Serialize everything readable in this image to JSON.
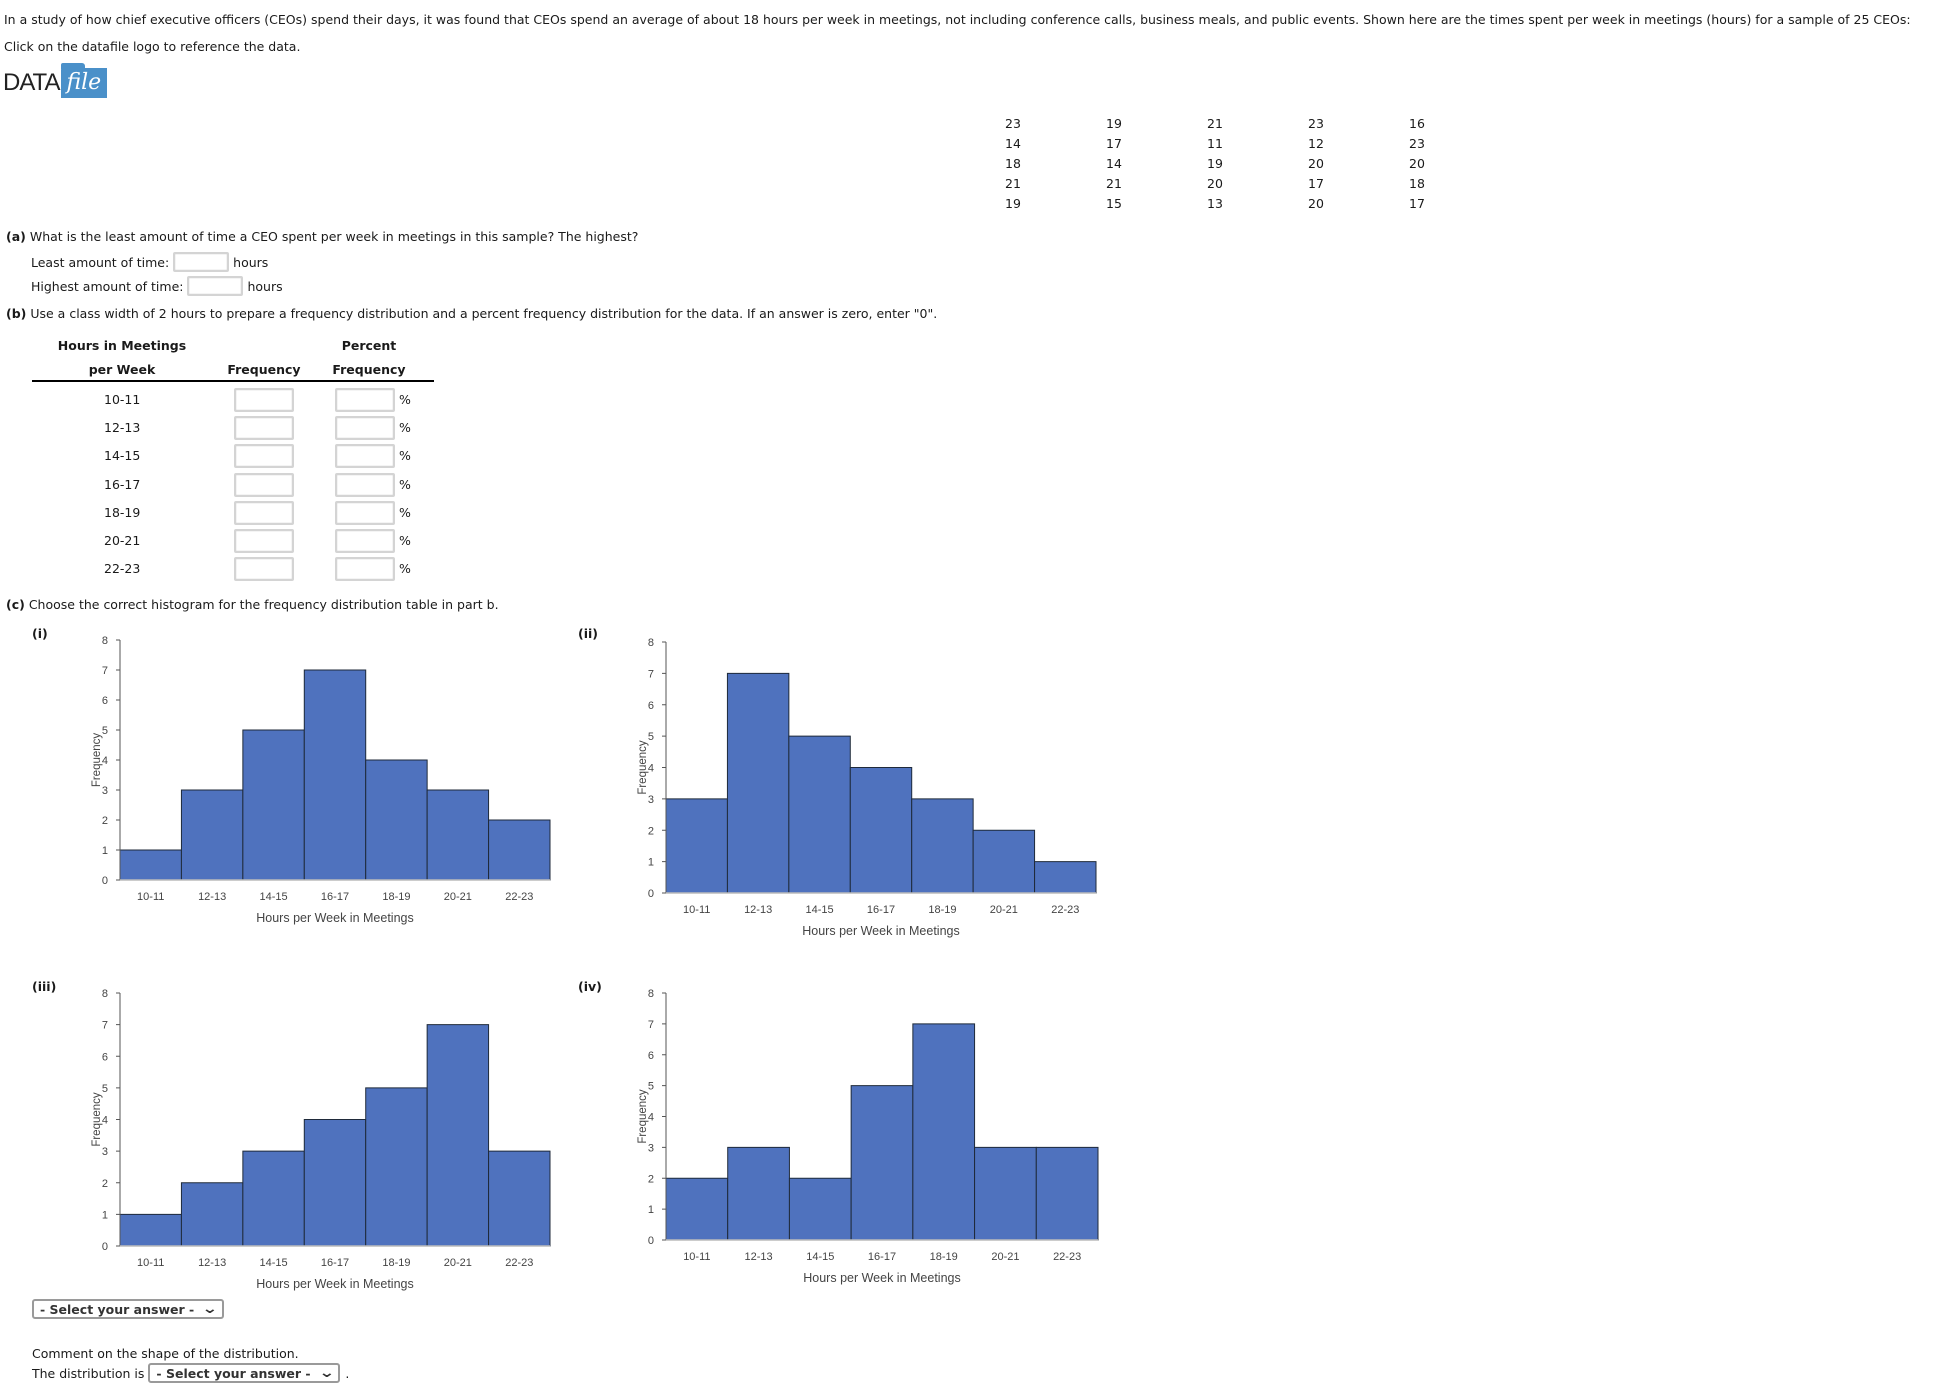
{
  "intro": {
    "text": "In a study of how chief executive officers (CEOs) spend their days, it was found that CEOs spend an average of about 18 hours per week in meetings, not including conference calls, business meals, and public events. Shown here are the times spent per week in meetings (hours) for a sample of 25 CEOs:",
    "datafile_note": "Click on the datafile logo to reference the data."
  },
  "logo": {
    "data": "DATA",
    "file": "file",
    "icon": "datafile-logo-icon"
  },
  "sample_data": [
    [
      "23",
      "19",
      "21",
      "23",
      "16"
    ],
    [
      "14",
      "17",
      "11",
      "12",
      "23"
    ],
    [
      "18",
      "14",
      "19",
      "20",
      "20"
    ],
    [
      "21",
      "21",
      "20",
      "17",
      "18"
    ],
    [
      "19",
      "15",
      "13",
      "20",
      "17"
    ]
  ],
  "part_a": {
    "label": "(a)",
    "question": "What is the least amount of time a CEO spent per week in meetings in this sample? The highest?",
    "least_label": "Least amount of time:",
    "least_value": "",
    "highest_label": "Highest amount of time:",
    "highest_value": "",
    "unit": "hours"
  },
  "part_b": {
    "label": "(b)",
    "question": "Use a class width of 2 hours to prepare a frequency distribution and a percent frequency distribution for the data. If an answer is zero, enter \"0\".",
    "headers": {
      "col1_line1": "Hours in Meetings",
      "col1_line2": "per Week",
      "col2": "Frequency",
      "col3_line1": "Percent",
      "col3_line2": "Frequency"
    },
    "percent_sign": "%",
    "rows": [
      {
        "class": "10-11",
        "frequency": "",
        "percent": ""
      },
      {
        "class": "12-13",
        "frequency": "",
        "percent": ""
      },
      {
        "class": "14-15",
        "frequency": "",
        "percent": ""
      },
      {
        "class": "16-17",
        "frequency": "",
        "percent": ""
      },
      {
        "class": "18-19",
        "frequency": "",
        "percent": ""
      },
      {
        "class": "20-21",
        "frequency": "",
        "percent": ""
      },
      {
        "class": "22-23",
        "frequency": "",
        "percent": ""
      }
    ]
  },
  "part_c": {
    "label": "(c)",
    "question": "Choose the correct histogram for the frequency distribution table in part b.",
    "answer_select": "- Select your answer -",
    "shape_prompt": "Comment on the shape of the distribution.",
    "shape_prefix": "The distribution is",
    "shape_select": "- Select your answer -",
    "shape_suffix": "."
  },
  "colors": {
    "bar": "#4F72BE",
    "bar_edge": "#1f2a3a",
    "logo_blue": "#4A90C9"
  },
  "chart_data": [
    {
      "id": "i",
      "label": "(i)",
      "type": "bar",
      "categories": [
        "10-11",
        "12-13",
        "14-15",
        "16-17",
        "18-19",
        "20-21",
        "22-23"
      ],
      "values": [
        1,
        3,
        5,
        7,
        4,
        3,
        2
      ],
      "xlabel": "Hours per Week in Meetings",
      "ylabel": "Frequency",
      "ylim": [
        0,
        8
      ],
      "yticks": [
        0,
        1,
        2,
        3,
        4,
        5,
        6,
        7,
        8
      ],
      "grid": false
    },
    {
      "id": "ii",
      "label": "(ii)",
      "type": "bar",
      "categories": [
        "10-11",
        "12-13",
        "14-15",
        "16-17",
        "18-19",
        "20-21",
        "22-23"
      ],
      "values": [
        3,
        7,
        5,
        4,
        3,
        2,
        1
      ],
      "xlabel": "Hours per Week in Meetings",
      "ylabel": "Frequency",
      "ylim": [
        0,
        8
      ],
      "yticks": [
        0,
        1,
        2,
        3,
        4,
        5,
        6,
        7,
        8
      ],
      "grid": false
    },
    {
      "id": "iii",
      "label": "(iii)",
      "type": "bar",
      "categories": [
        "10-11",
        "12-13",
        "14-15",
        "16-17",
        "18-19",
        "20-21",
        "22-23"
      ],
      "values": [
        1,
        2,
        3,
        4,
        5,
        7,
        3
      ],
      "xlabel": "Hours per Week in Meetings",
      "ylabel": "Frequency",
      "ylim": [
        0,
        8
      ],
      "yticks": [
        0,
        1,
        2,
        3,
        4,
        5,
        6,
        7,
        8
      ],
      "grid": false
    },
    {
      "id": "iv",
      "label": "(iv)",
      "type": "bar",
      "categories": [
        "10-11",
        "12-13",
        "14-15",
        "16-17",
        "18-19",
        "20-21",
        "22-23"
      ],
      "values": [
        2,
        3,
        2,
        5,
        7,
        3,
        3
      ],
      "xlabel": "Hours per Week in Meetings",
      "ylabel": "Frequency",
      "ylim": [
        0,
        8
      ],
      "yticks": [
        0,
        1,
        2,
        3,
        4,
        5,
        6,
        7,
        8
      ],
      "grid": false
    }
  ]
}
